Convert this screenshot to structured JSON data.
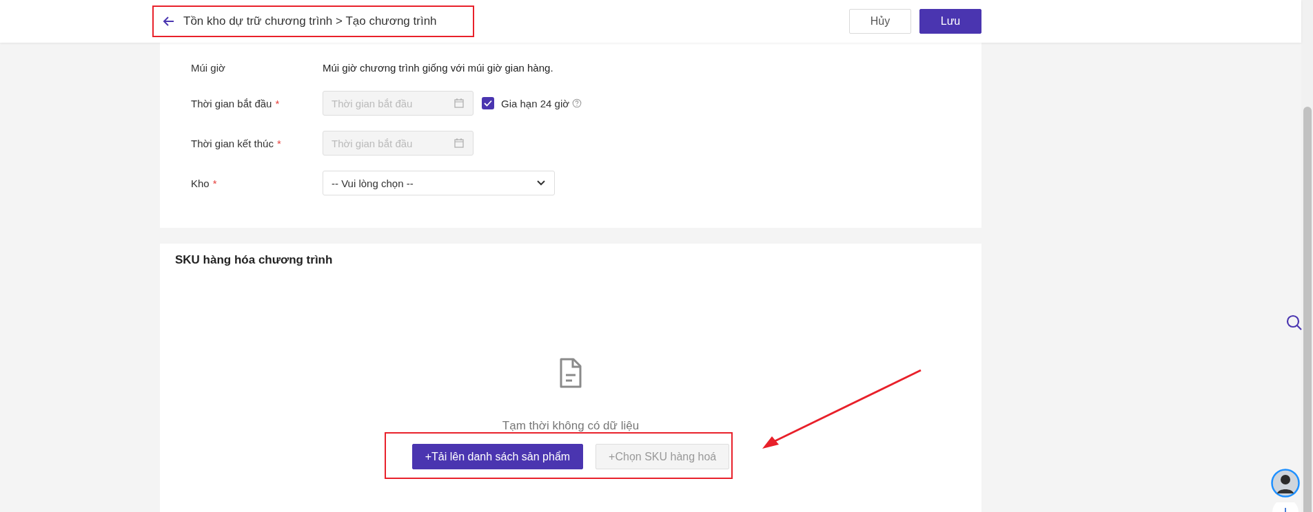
{
  "header": {
    "breadcrumb": "Tồn kho dự trữ chương trình > Tạo chương trình",
    "buttons": [
      {
        "label": "Hủy",
        "kind": "secondary"
      },
      {
        "label": "Lưu",
        "kind": "primary"
      }
    ]
  },
  "form": {
    "rows": [
      {
        "kind": "text",
        "label": "Múi giờ",
        "value": "Múi giờ chương trình giống với múi giờ gian hàng."
      },
      {
        "kind": "date",
        "label": "Thời gian bắt đầu",
        "required_mark": "*",
        "placeholder": "Thời gian bắt đầu",
        "disabled": true,
        "checkbox": {
          "label": "Gia hạn 24 giờ",
          "checked": true
        }
      },
      {
        "kind": "date",
        "label": "Thời gian kết thúc",
        "required_mark": "*",
        "placeholder": "Thời gian bắt đầu",
        "disabled": true
      },
      {
        "kind": "select",
        "label": "Kho",
        "required_mark": "*",
        "value": "-- Vui lòng chọn --"
      }
    ]
  },
  "sku_section": {
    "title": "SKU hàng hóa chương trình",
    "empty_text": "Tạm thời không có dữ liệu",
    "actions": [
      {
        "label": "+Tải lên danh sách sản phẩm",
        "disabled": false
      },
      {
        "label": "+Chọn SKU hàng hoá",
        "disabled": true
      }
    ]
  }
}
